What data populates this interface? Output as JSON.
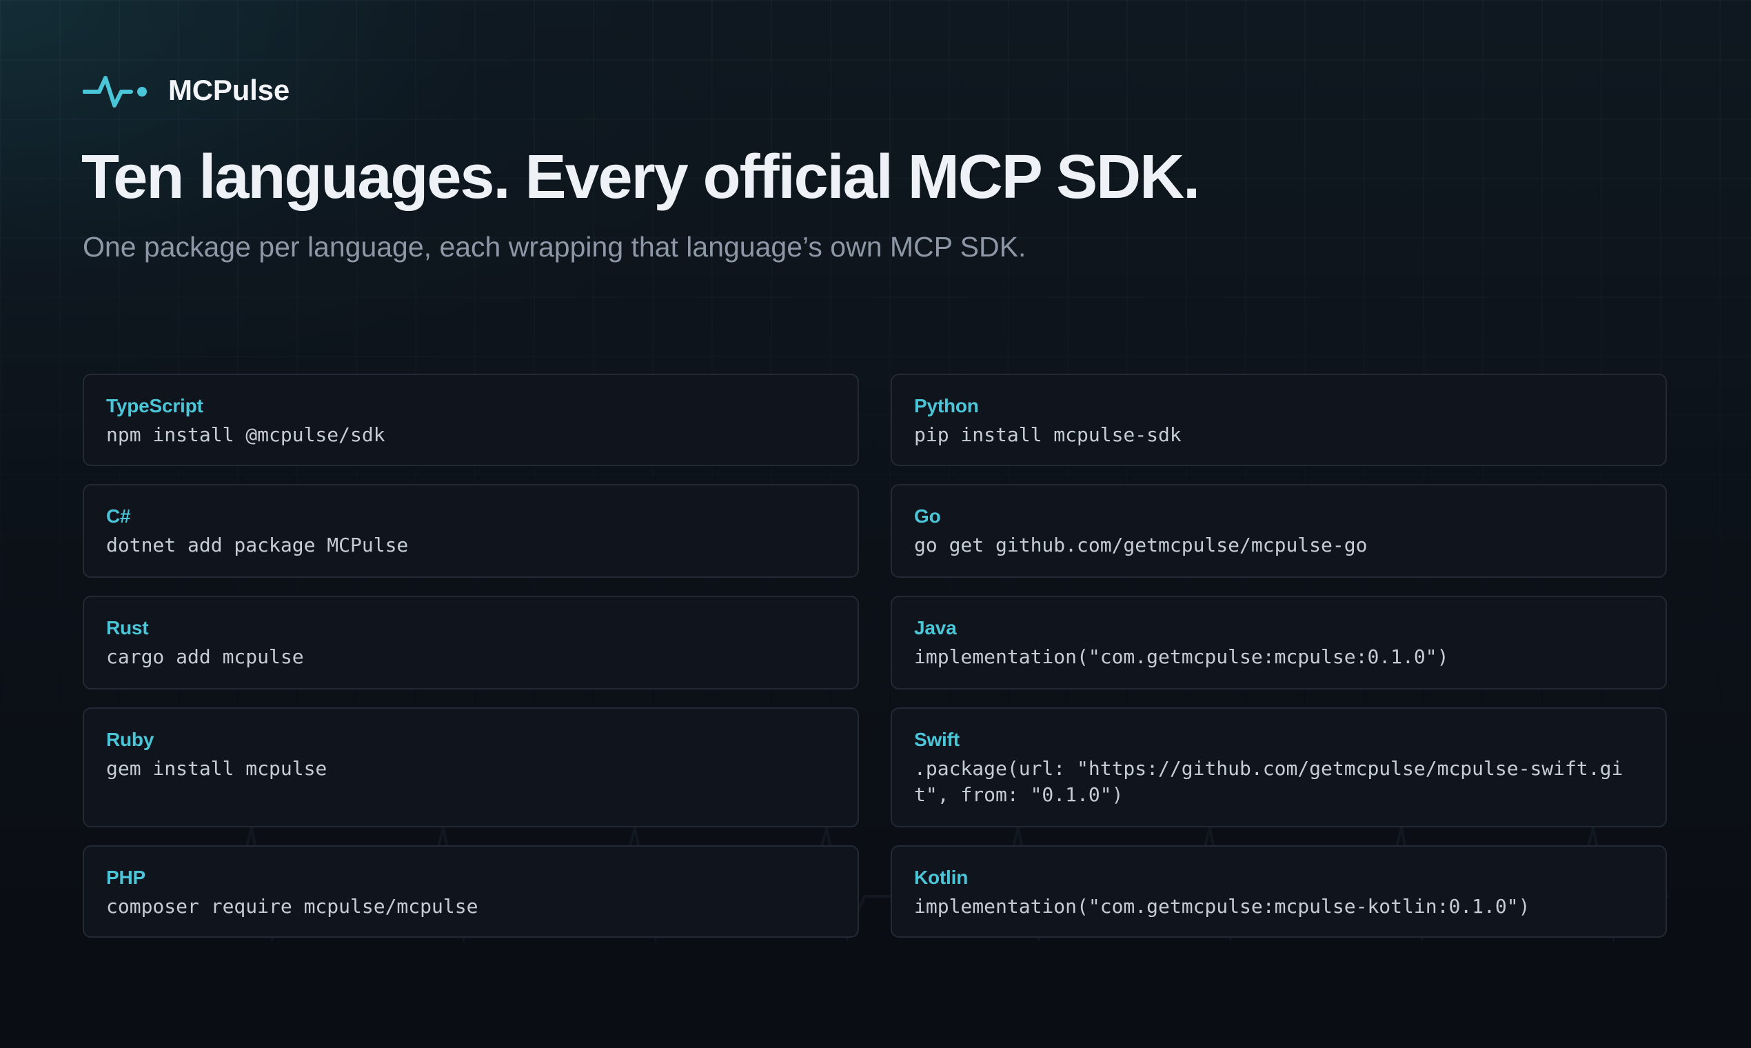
{
  "brand": {
    "name": "MCPulse",
    "icon": "pulse-heartbeat-icon",
    "accent_color": "#4ac6d8"
  },
  "hero": {
    "title": "Ten languages. Every official MCP SDK.",
    "subtitle": "One package per language, each wrapping that language’s own MCP SDK."
  },
  "sdks": [
    {
      "language": "TypeScript",
      "install": "npm install @mcpulse/sdk"
    },
    {
      "language": "Python",
      "install": "pip install mcpulse-sdk"
    },
    {
      "language": "C#",
      "install": "dotnet add package MCPulse"
    },
    {
      "language": "Go",
      "install": "go get github.com/getmcpulse/mcpulse-go"
    },
    {
      "language": "Rust",
      "install": "cargo add mcpulse"
    },
    {
      "language": "Java",
      "install": "implementation(\"com.getmcpulse:mcpulse:0.1.0\")"
    },
    {
      "language": "Ruby",
      "install": "gem install mcpulse"
    },
    {
      "language": "Swift",
      "install": ".package(url: \"https://github.com/getmcpulse/mcpulse-swift.git\", from: \"0.1.0\")"
    },
    {
      "language": "PHP",
      "install": "composer require mcpulse/mcpulse"
    },
    {
      "language": "Kotlin",
      "install": "implementation(\"com.getmcpulse:mcpulse-kotlin:0.1.0\")"
    }
  ]
}
